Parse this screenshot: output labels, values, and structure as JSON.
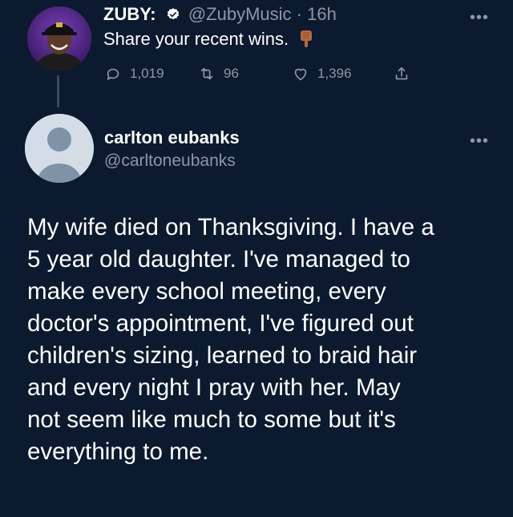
{
  "parent_tweet": {
    "author_name": "ZUBY:",
    "handle": "@ZubyMusic",
    "separator": "·",
    "time_ago": "16h",
    "text": "Share your recent wins.",
    "emoji": "backhand-index-pointing-down",
    "more_icon": "more-icon",
    "actions": {
      "replies": "1,019",
      "retweets": "96",
      "likes": "1,396"
    }
  },
  "main_tweet": {
    "display_name": "carlton eubanks",
    "handle": "@carltoneubanks",
    "more_icon": "more-icon",
    "text_lines": [
      "My wife died on Thanksgiving. I have a",
      "5 year old daughter. I've managed to",
      "make every school meeting, every",
      "doctor's appointment, I've figured out",
      "children's sizing, learned to braid hair",
      "and every night I pray with her. May",
      "not seem like much to some but it's",
      "everything to me."
    ]
  },
  "colors": {
    "background": "#0b1a2e",
    "text_primary": "#ffffff",
    "text_muted": "#8b98a5",
    "verified": "#ffffff"
  }
}
